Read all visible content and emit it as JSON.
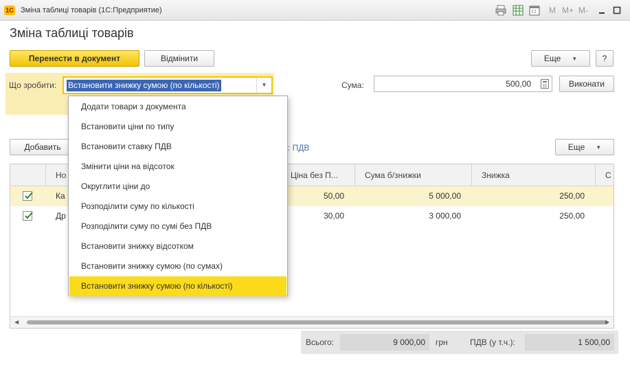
{
  "window": {
    "title": "Зміна таблиці товарів  (1С:Предприятие)",
    "app_logo": "1С",
    "toolbar_m": "M",
    "toolbar_mplus": "M+",
    "toolbar_mminus": "M-"
  },
  "header": {
    "title": "Зміна таблиці товарів",
    "transfer_label": "Перенести в документ",
    "cancel_label": "Відмінити",
    "more_label": "Еще",
    "help_label": "?"
  },
  "action": {
    "what_label": "Що зробити:",
    "selected_value": "Встановити знижку сумою (по кількості)",
    "amount_label": "Сума:",
    "amount_value": "500,00",
    "execute_label": "Виконати"
  },
  "dropdown": {
    "items": [
      "Додати товари з документа",
      "Встановити ціни по типу",
      "Встановити ставку ПДВ",
      "Змінити ціни на відсоток",
      "Округлити ціни до",
      "Розподілити суму по кількості",
      "Розподілити суму по сумі без ПДВ",
      "Встановити знижку відсотком",
      "Встановити знижку сумою (по сумах)",
      "Встановити знижку сумою (по кількості)"
    ],
    "active_index": 9
  },
  "table_toolbar": {
    "add_label": "Добавить",
    "vat_link_fragment": ": ПДВ",
    "more_label": "Еще"
  },
  "table": {
    "columns": [
      "Но",
      "Ціна без П...",
      "Сума б/знижки",
      "Знижка",
      "С"
    ],
    "rows": [
      {
        "checked": true,
        "name": "Ка",
        "price": "50,00",
        "sum": "5 000,00",
        "discount": "250,00"
      },
      {
        "checked": true,
        "name": "Др",
        "price": "30,00",
        "sum": "3 000,00",
        "discount": "250,00"
      }
    ]
  },
  "totals": {
    "total_label": "Всього:",
    "total_value": "9 000,00",
    "currency": "грн",
    "vat_label": "ПДВ (у т.ч.):",
    "vat_value": "1 500,00"
  },
  "colors": {
    "accent_yellow": "#f2c500",
    "selection_blue": "#3a65b4",
    "row_highlight": "#fbf3cc",
    "dropdown_active": "#fbdb1a"
  }
}
